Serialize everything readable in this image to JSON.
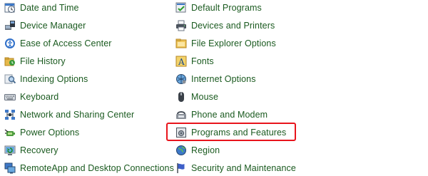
{
  "left_items": [
    {
      "label": "Date and Time",
      "icon": "clock-calendar-icon"
    },
    {
      "label": "Device Manager",
      "icon": "device-manager-icon"
    },
    {
      "label": "Ease of Access Center",
      "icon": "ease-of-access-icon"
    },
    {
      "label": "File History",
      "icon": "file-history-icon"
    },
    {
      "label": "Indexing Options",
      "icon": "indexing-icon"
    },
    {
      "label": "Keyboard",
      "icon": "keyboard-icon"
    },
    {
      "label": "Network and Sharing Center",
      "icon": "network-icon"
    },
    {
      "label": "Power Options",
      "icon": "power-icon"
    },
    {
      "label": "Recovery",
      "icon": "recovery-icon"
    },
    {
      "label": "RemoteApp and Desktop Connections",
      "icon": "remote-desktop-icon"
    }
  ],
  "right_items": [
    {
      "label": "Default Programs",
      "icon": "default-programs-icon"
    },
    {
      "label": "Devices and Printers",
      "icon": "printer-icon"
    },
    {
      "label": "File Explorer Options",
      "icon": "folder-options-icon"
    },
    {
      "label": "Fonts",
      "icon": "fonts-icon"
    },
    {
      "label": "Internet Options",
      "icon": "internet-options-icon"
    },
    {
      "label": "Mouse",
      "icon": "mouse-icon"
    },
    {
      "label": "Phone and Modem",
      "icon": "phone-modem-icon"
    },
    {
      "label": "Programs and Features",
      "icon": "programs-features-icon"
    },
    {
      "label": "Region",
      "icon": "region-icon"
    },
    {
      "label": "Security and Maintenance",
      "icon": "security-flag-icon"
    }
  ],
  "highlighted_item": "Programs and Features",
  "colors": {
    "link": "#1a5a1f",
    "highlight_border": "#e8141c"
  }
}
